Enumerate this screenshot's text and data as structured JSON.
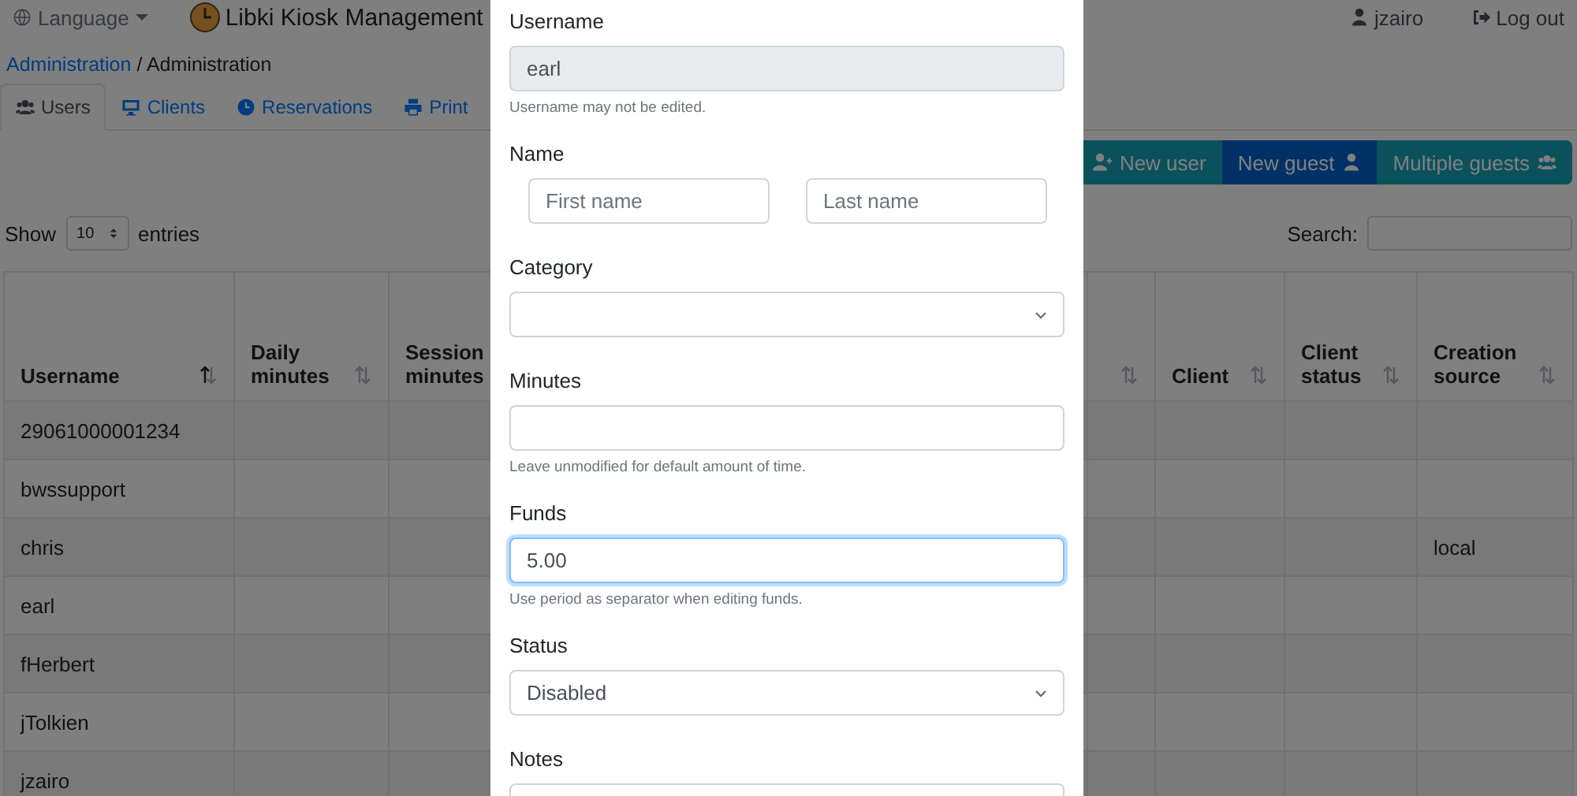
{
  "navbar": {
    "language": "Language",
    "title": "Libki Kiosk Management",
    "user": "jzairo",
    "logout": "Log out"
  },
  "breadcrumb": {
    "link": "Administration",
    "separator": "/",
    "current": "Administration"
  },
  "tabs": [
    {
      "label": "Users",
      "selected": true
    },
    {
      "label": "Clients",
      "selected": false
    },
    {
      "label": "Reservations",
      "selected": false
    },
    {
      "label": "Print",
      "selected": false
    }
  ],
  "actions": [
    {
      "label": "New user",
      "kind": "info"
    },
    {
      "label": "New guest",
      "kind": "primary"
    },
    {
      "label": "Multiple guests",
      "kind": "info"
    }
  ],
  "length": {
    "before": "Show",
    "value": "10",
    "after": "entries"
  },
  "search": {
    "label": "Search:"
  },
  "table": {
    "columns": [
      {
        "label": "Username",
        "sorted": true
      },
      {
        "label": "Daily minutes",
        "sorted": false
      },
      {
        "label": "Session minutes"
      },
      {
        "sorted": false
      },
      {
        "label": "Client",
        "sorted": false
      },
      {
        "label": "Client status",
        "sorted": false
      },
      {
        "label": "Creation source",
        "sorted": false
      }
    ],
    "rows": [
      {
        "username": "29061000001234"
      },
      {
        "username": "bwssupport"
      },
      {
        "username": "chris",
        "creation_source": "local"
      },
      {
        "username": "earl"
      },
      {
        "username": "fHerbert"
      },
      {
        "username": "jTolkien"
      },
      {
        "username": "jzairo"
      },
      {}
    ]
  },
  "modal": {
    "fields": [
      {
        "kind": "input",
        "label": "Username",
        "value": "earl",
        "disabled": true,
        "help": "Username may not be edited."
      },
      {
        "kind": "name",
        "label": "Name",
        "first_placeholder": "First name",
        "last_placeholder": "Last name"
      },
      {
        "kind": "select",
        "label": "Category"
      },
      {
        "kind": "input",
        "label": "Minutes",
        "help": "Leave unmodified for default amount of time.",
        "disabled": false
      },
      {
        "kind": "input",
        "label": "Funds",
        "value": "5.00",
        "focused": true,
        "disabled": false,
        "help": "Use period as separator when editing funds."
      },
      {
        "kind": "select",
        "label": "Status",
        "value": "Disabled"
      },
      {
        "kind": "textarea",
        "label": "Notes"
      }
    ]
  }
}
